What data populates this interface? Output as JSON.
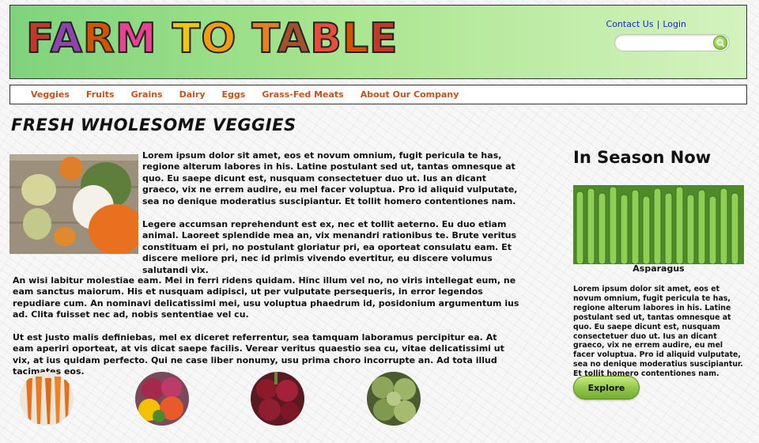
{
  "header": {
    "logo_text": "FARM TO TABLE",
    "links": {
      "contact": "Contact Us",
      "separator": "|",
      "login": "Login"
    },
    "search": {
      "placeholder": "",
      "value": ""
    }
  },
  "nav": {
    "items": [
      {
        "label": "Veggies"
      },
      {
        "label": "Fruits"
      },
      {
        "label": "Grains"
      },
      {
        "label": "Dairy"
      },
      {
        "label": "Eggs"
      },
      {
        "label": "Grass-Fed Meats"
      },
      {
        "label": "About Our Company"
      }
    ]
  },
  "main": {
    "title": "FRESH WHOLESOME VEGGIES",
    "paragraphs": [
      "Lorem ipsum dolor sit amet, eos et novum omnium, fugit pericula te has, regione alterum labores in his. Latine postulant sed ut, tantas omnesque at quo. Eu saepe dicunt est, nusquam consectetuer duo ut. Ius an dicant graeco, vix ne errem audire, eu mel facer voluptua. Pro id aliquid vulputate, sea no denique moderatius suscipiantur. Et tollit homero contentiones nam.",
      "Legere accumsan reprehendunt est ex, nec et tollit aeterno. Eu duo etiam animal. Laoreet splendide mea an, vix menandri rationibus te. Brute veritus constituam ei pri, no postulant gloriatur pri, ea oporteat consulatu eam. Et discere meliore pri, nec id primis vivendo evertitur, eu discere volumus salutandi vix.",
      "An wisi labitur molestiae eam. Mei in ferri ridens quidam. Hinc illum vel no, no viris intellegat eum, ne eam sanctus maiorum. His et nusquam adipisci, ut per vulputate persequeris, in error legendos repudiare cum. An nominavi delicatissimi mei, usu voluptua phaedrum id, posidonium argumentum ius ad. Clita fuisset nec ad, nobis sententiae vel cu.",
      "Ut est justo malis definiebas, mel ex diceret referrentur, sea tamquam laboramus percipitur ea. At eam aperiri oporteat, at vis dicat saepe facilis. Verear veritus quaestio sea cu, vitae delicatissimi ut vix, at ius quidam perfecto. Qui ne case liber nonumy, usu prima choro incorrupte an. Ad tota illud tacimates eos."
    ]
  },
  "sidebar": {
    "title": "In Season Now",
    "caption": "Asparagus",
    "text": "Lorem ipsum dolor sit amet, eos et novum omnium, fugit pericula te has, regione alterum labores in his. Latine postulant sed ut, tantas omnesque at quo. Eu saepe dicunt est, nusquam consectetuer duo ut. Ius an dicant graeco, vix ne errem audire, eu mel facer voluptua. Pro id aliquid vulputate, sea no denique moderatius suscipiantur. Et tollit homero contentiones nam.",
    "button_label": "Explore"
  },
  "colors": {
    "header_green": "#a9e58f",
    "nav_link": "#c4521c",
    "top_link": "#1a28c9",
    "button_green": "#8fc44a"
  }
}
